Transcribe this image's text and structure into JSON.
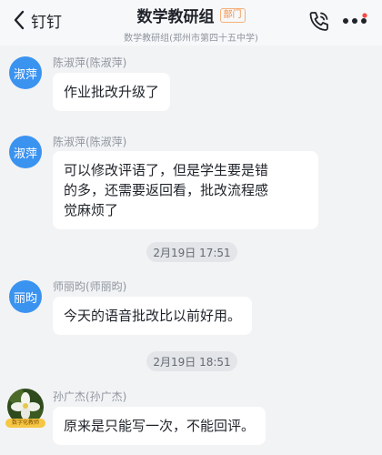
{
  "header": {
    "back_label": "钉钉",
    "title": "数学教研组",
    "badge": "部门",
    "subtitle": "数学教研组(郑州市第四十五中学)"
  },
  "messages": [
    {
      "avatar_text": "淑萍",
      "sender": "陈淑萍(陈淑萍)",
      "text": "作业批改升级了"
    },
    {
      "avatar_text": "淑萍",
      "sender": "陈淑萍(陈淑萍)",
      "lines": [
        "可以修改评语了，但是学生要是错",
        "的多，还需要返回看，批改流程感",
        "觉麻烦了"
      ]
    },
    {
      "avatar_text": "丽昀",
      "sender": "师丽昀(师丽昀)",
      "text": "今天的语音批改比以前好用。"
    },
    {
      "sender": "孙广杰(孙广杰)",
      "avatar_tag": "数字化教师",
      "text": "原来是只能写一次，不能回评。"
    }
  ],
  "timestamps": [
    "2月19日 17:51",
    "2月19日 18:51"
  ],
  "colors": {
    "avatar_blue": "#3b93f0",
    "badge_orange": "#f08c3d",
    "background": "#f2f3f5"
  },
  "icons": {
    "back": "chevron-left-icon",
    "call": "phone-call-icon",
    "more": "more-dots-icon"
  }
}
